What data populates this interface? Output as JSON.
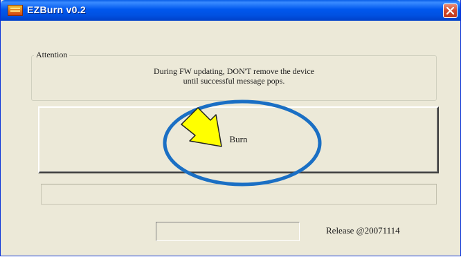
{
  "window": {
    "title": "EZBurn v0.2",
    "app_icon": "burn-app-icon",
    "close_icon": "close-icon"
  },
  "attention": {
    "legend": "Attention",
    "line1": "During FW updating, DON'T remove the device",
    "line2": "until successful message pops."
  },
  "burn_button": {
    "label": "Burn"
  },
  "progress": {
    "value": 0
  },
  "status": {
    "text": ""
  },
  "footer": {
    "release": "Release @20071114"
  },
  "annotation": {
    "arrow_icon": "pointer-arrow-icon",
    "highlight": "highlight-ellipse",
    "arrow_color": "#ffff00",
    "ellipse_color": "#1a6fc4"
  }
}
